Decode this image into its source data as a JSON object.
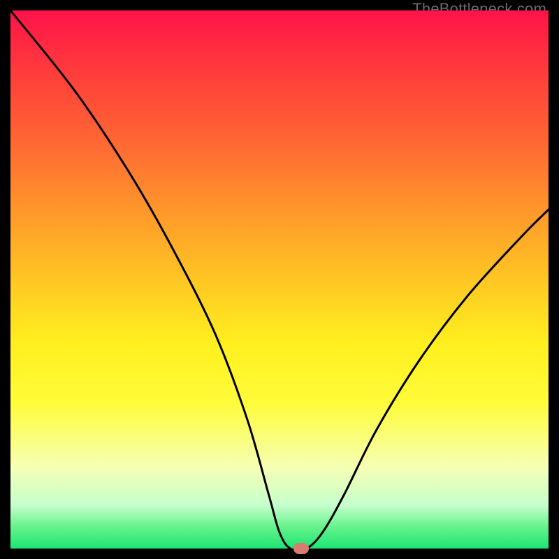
{
  "watermark": "TheBottleneck.com",
  "chart_data": {
    "type": "line",
    "title": "",
    "xlabel": "",
    "ylabel": "",
    "xlim": [
      0,
      100
    ],
    "ylim": [
      0,
      100
    ],
    "grid": false,
    "legend": false,
    "series": [
      {
        "name": "curve",
        "x": [
          0,
          12,
          22,
          30,
          38,
          44,
          48,
          50,
          52,
          55,
          58,
          62,
          68,
          76,
          85,
          95,
          100
        ],
        "values": [
          100,
          85,
          70,
          56,
          40,
          24,
          10,
          3,
          0,
          0,
          3,
          10,
          22,
          35,
          47,
          58,
          63
        ]
      }
    ],
    "marker": {
      "x": 54,
      "y": 0
    },
    "background_gradient": {
      "stops": [
        {
          "pos": 0,
          "color": "#ff124a"
        },
        {
          "pos": 12,
          "color": "#ff3e3a"
        },
        {
          "pos": 25,
          "color": "#ff6933"
        },
        {
          "pos": 38,
          "color": "#ff9a2a"
        },
        {
          "pos": 50,
          "color": "#ffc623"
        },
        {
          "pos": 62,
          "color": "#fff01f"
        },
        {
          "pos": 73,
          "color": "#fffc3a"
        },
        {
          "pos": 85,
          "color": "#f6ffb5"
        },
        {
          "pos": 92,
          "color": "#c5ffcc"
        },
        {
          "pos": 96,
          "color": "#65f28a"
        },
        {
          "pos": 100,
          "color": "#1de574"
        }
      ]
    }
  }
}
